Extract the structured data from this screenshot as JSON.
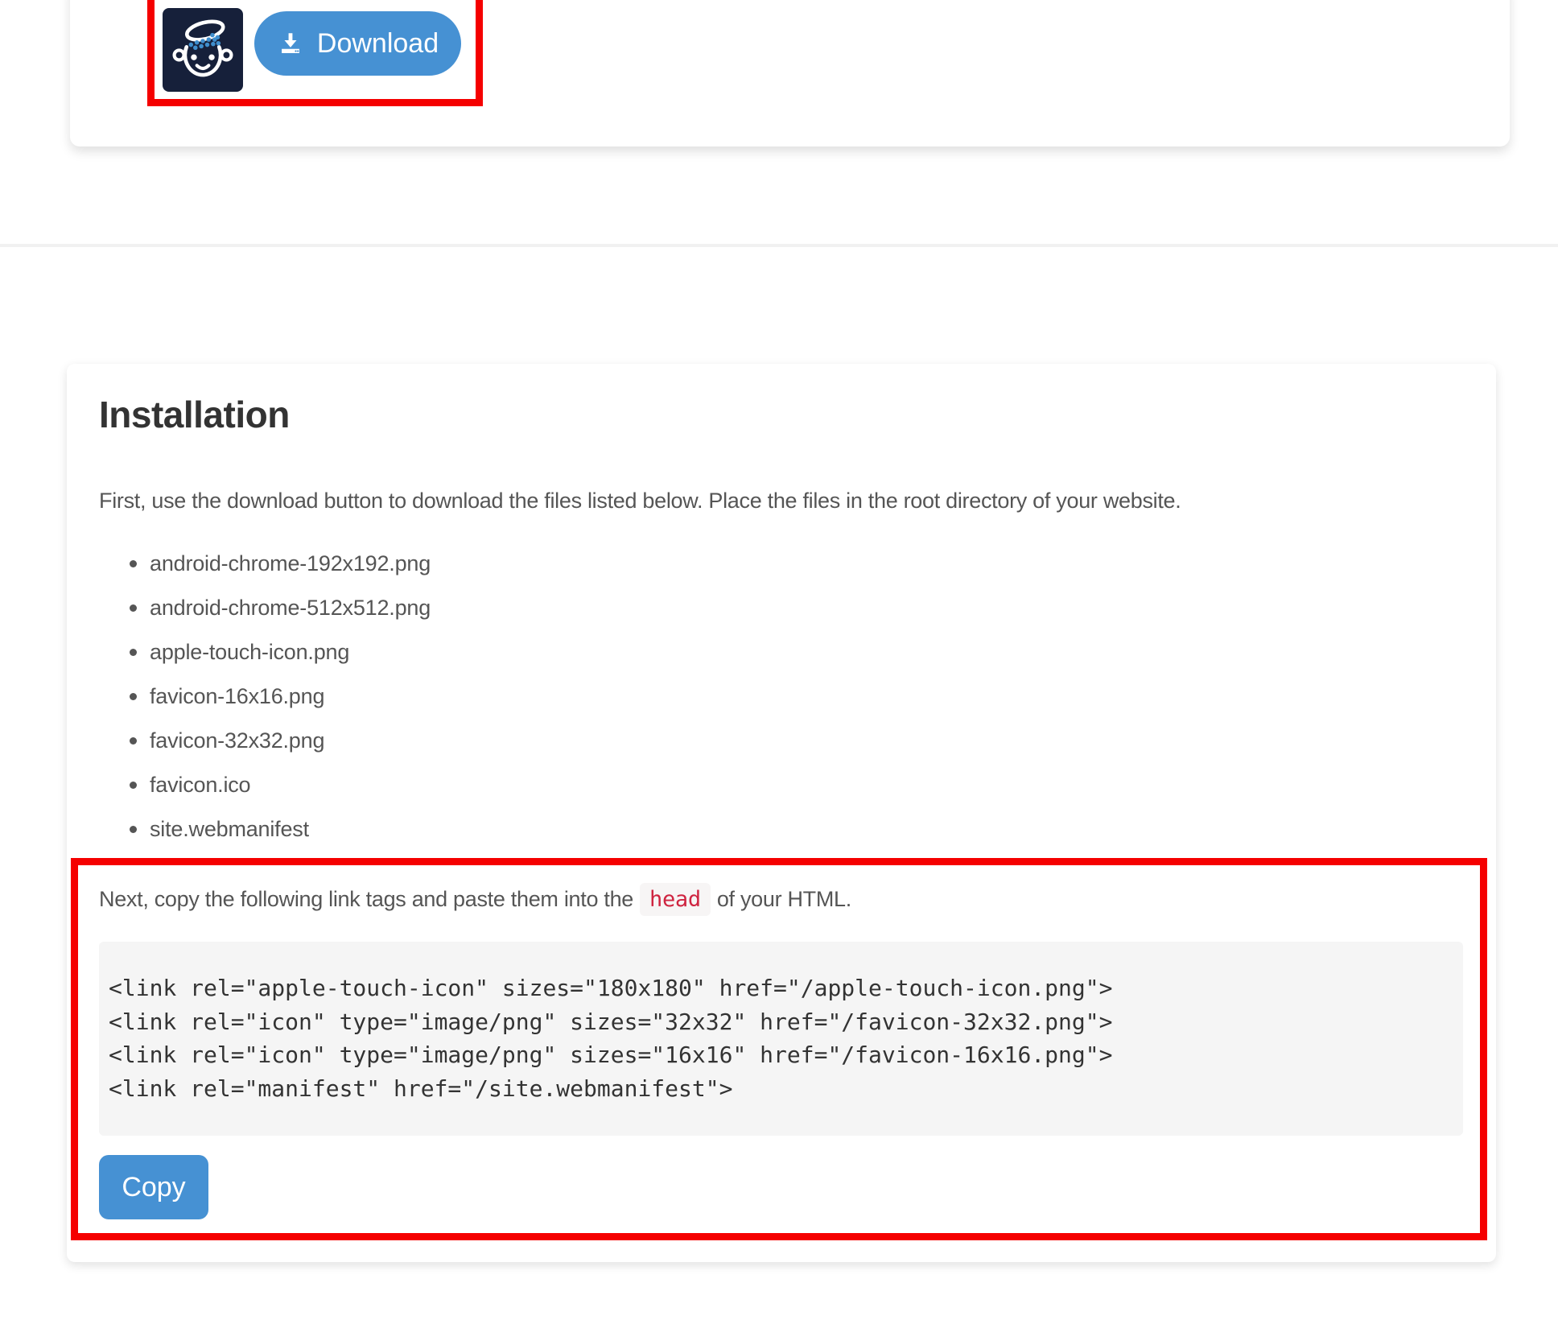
{
  "colors": {
    "annotation_red": "#f50000",
    "button_blue": "#4691d3",
    "icon_navy": "#16203a",
    "icon_dot_blue": "#3f8ecd",
    "inline_code_red": "#cf2440",
    "code_block_bg": "#f5f5f5",
    "heading_text": "#333333",
    "body_text": "#555555"
  },
  "top_card": {
    "app_icon": "favicon-brain-pot-logo",
    "download_label": "Download"
  },
  "installation": {
    "title": "Installation",
    "intro": "First, use the download button to download the files listed below. Place the files in the root directory of your website.",
    "files": [
      "android-chrome-192x192.png",
      "android-chrome-512x512.png",
      "apple-touch-icon.png",
      "favicon-16x16.png",
      "favicon-32x32.png",
      "favicon.ico",
      "site.webmanifest"
    ],
    "next_step": {
      "before": "Next, copy the following link tags and paste them into the",
      "code": "head",
      "after": "of your HTML."
    },
    "code_lines": [
      "<link rel=\"apple-touch-icon\" sizes=\"180x180\" href=\"/apple-touch-icon.png\">",
      "<link rel=\"icon\" type=\"image/png\" sizes=\"32x32\" href=\"/favicon-32x32.png\">",
      "<link rel=\"icon\" type=\"image/png\" sizes=\"16x16\" href=\"/favicon-16x16.png\">",
      "<link rel=\"manifest\" href=\"/site.webmanifest\">"
    ],
    "copy_label": "Copy"
  }
}
